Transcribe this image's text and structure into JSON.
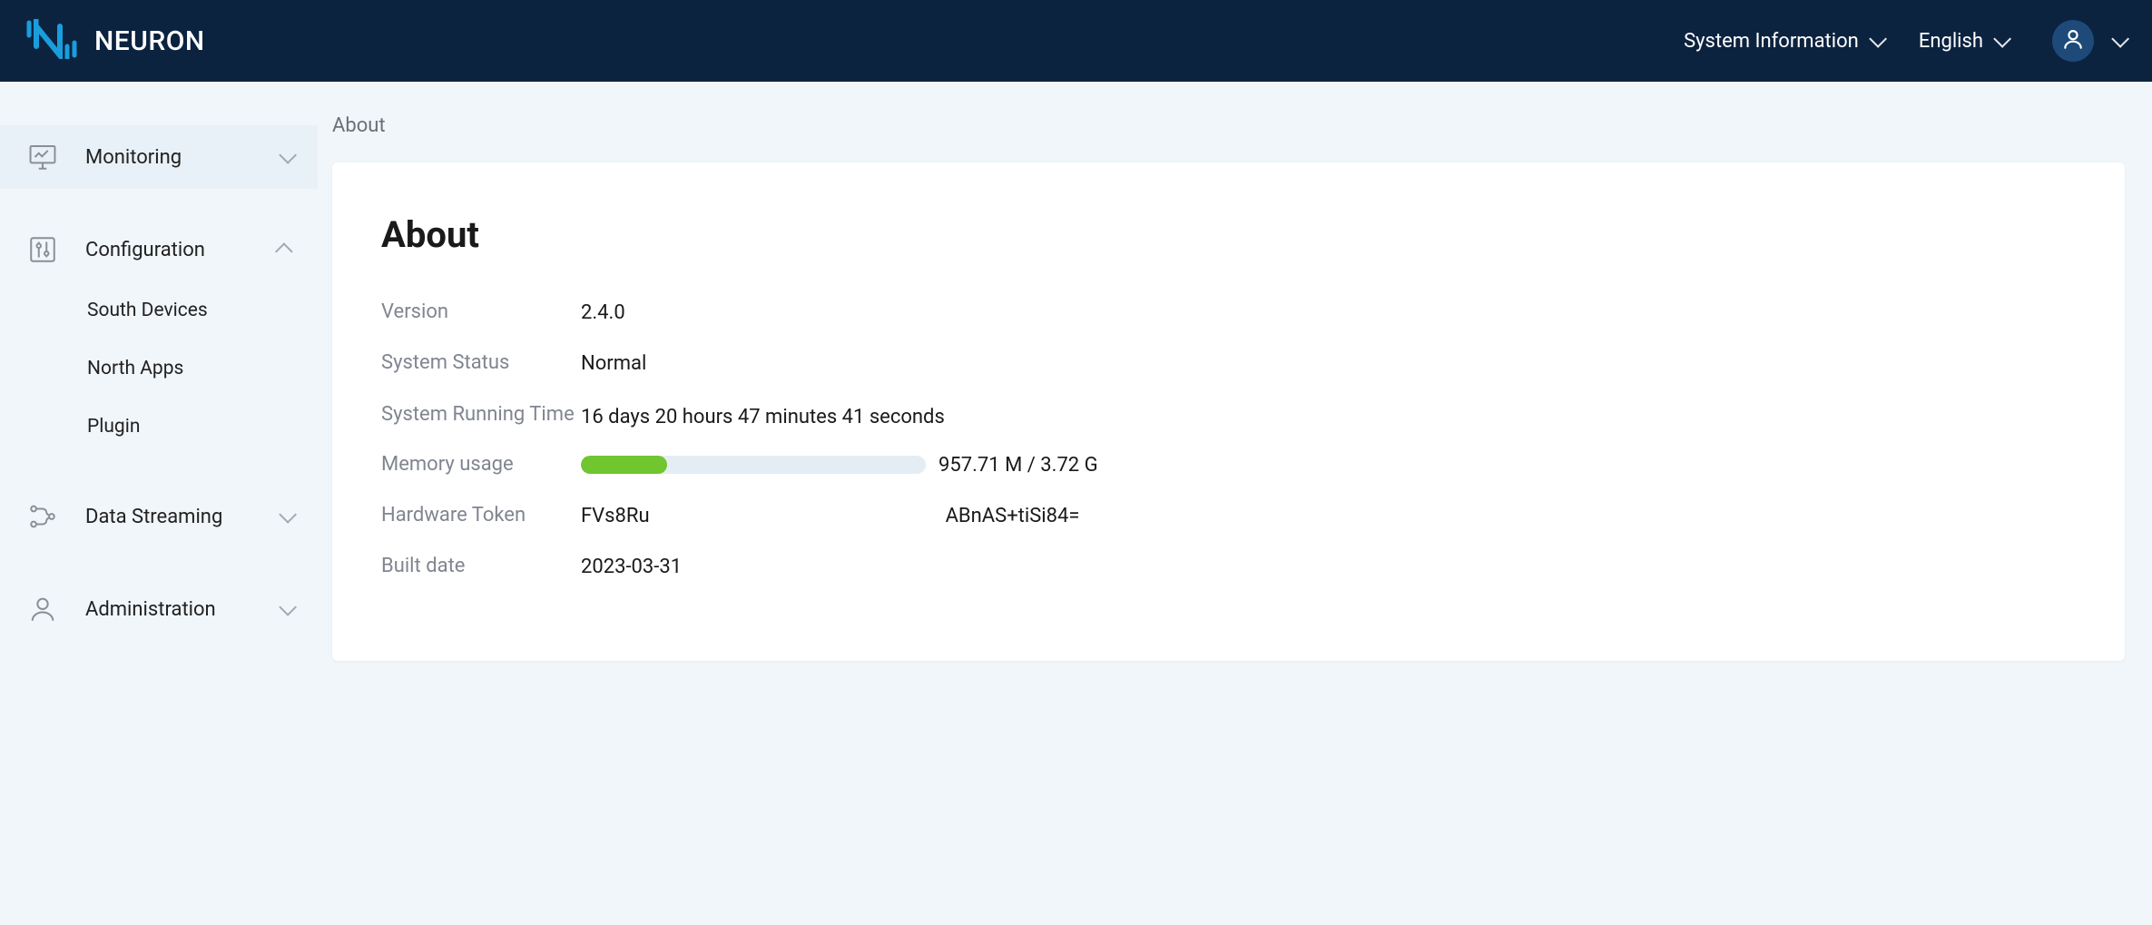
{
  "brand": {
    "name": "NEURON"
  },
  "header": {
    "sysinfo_label": "System Information",
    "language_label": "English"
  },
  "sidebar": {
    "monitoring_label": "Monitoring",
    "configuration_label": "Configuration",
    "configuration_items": {
      "south": "South Devices",
      "north": "North Apps",
      "plugin": "Plugin"
    },
    "datastreaming_label": "Data Streaming",
    "administration_label": "Administration"
  },
  "breadcrumb": "About",
  "page": {
    "title": "About",
    "labels": {
      "version": "Version",
      "system_status": "System Status",
      "running_time": "System Running Time",
      "memory_usage": "Memory usage",
      "hardware_token": "Hardware Token",
      "built_date": "Built date"
    },
    "values": {
      "version": "2.4.0",
      "system_status": "Normal",
      "running_time": "16 days 20 hours 47 minutes 41 seconds",
      "memory_used": "957.71 M",
      "memory_total": "3.72 G",
      "memory_text": "957.71 M / 3.72 G",
      "memory_percent": 25,
      "hardware_token_prefix": "FVs8Ru",
      "hardware_token_suffix": "ABnAS+tiSi84=",
      "built_date": "2023-03-31"
    }
  }
}
